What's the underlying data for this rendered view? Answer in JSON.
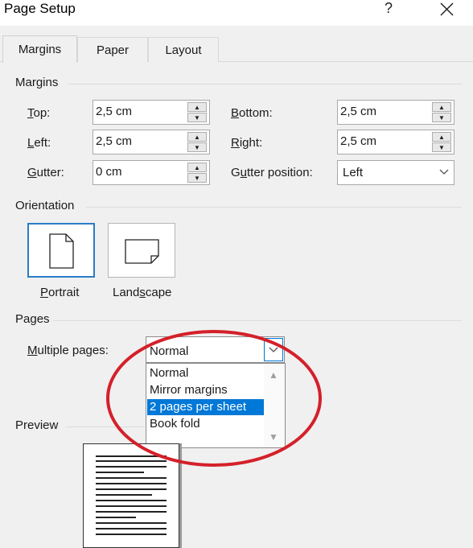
{
  "dialog": {
    "title": "Page Setup",
    "help_label": "?",
    "close_icon": "close-icon"
  },
  "tabs": [
    {
      "label": "Margins",
      "active": true
    },
    {
      "label": "Paper",
      "active": false
    },
    {
      "label": "Layout",
      "active": false
    }
  ],
  "margins": {
    "section_label": "Margins",
    "top": {
      "label_u": "T",
      "label_rest": "op:",
      "value": "2,5 cm"
    },
    "left": {
      "label_u": "L",
      "label_rest": "eft:",
      "value": "2,5 cm"
    },
    "gutter": {
      "label_u": "G",
      "label_rest": "utter:",
      "value": "0 cm"
    },
    "bottom": {
      "label_u": "B",
      "label_rest": "ottom:",
      "value": "2,5 cm"
    },
    "right": {
      "label_u": "R",
      "label_rest": "ight:",
      "value": "2,5 cm"
    },
    "gutter_position": {
      "label_pre": "G",
      "label_u": "u",
      "label_rest": "tter position:",
      "value": "Left"
    }
  },
  "orientation": {
    "section_label": "Orientation",
    "portrait": {
      "label_u": "P",
      "label_rest": "ortrait",
      "selected": true
    },
    "landscape": {
      "label_pre": "Land",
      "label_u": "s",
      "label_rest": "cape",
      "selected": false
    }
  },
  "pages": {
    "section_label": "Pages",
    "multiple_pages": {
      "label_u": "M",
      "label_rest": "ultiple pages:",
      "value": "Normal",
      "options": [
        "Normal",
        "Mirror margins",
        "2 pages per sheet",
        "Book fold"
      ],
      "highlighted": "2 pages per sheet"
    }
  },
  "preview": {
    "section_label": "Preview"
  },
  "colors": {
    "accent": "#0078d7",
    "annotation": "#d4202a"
  }
}
